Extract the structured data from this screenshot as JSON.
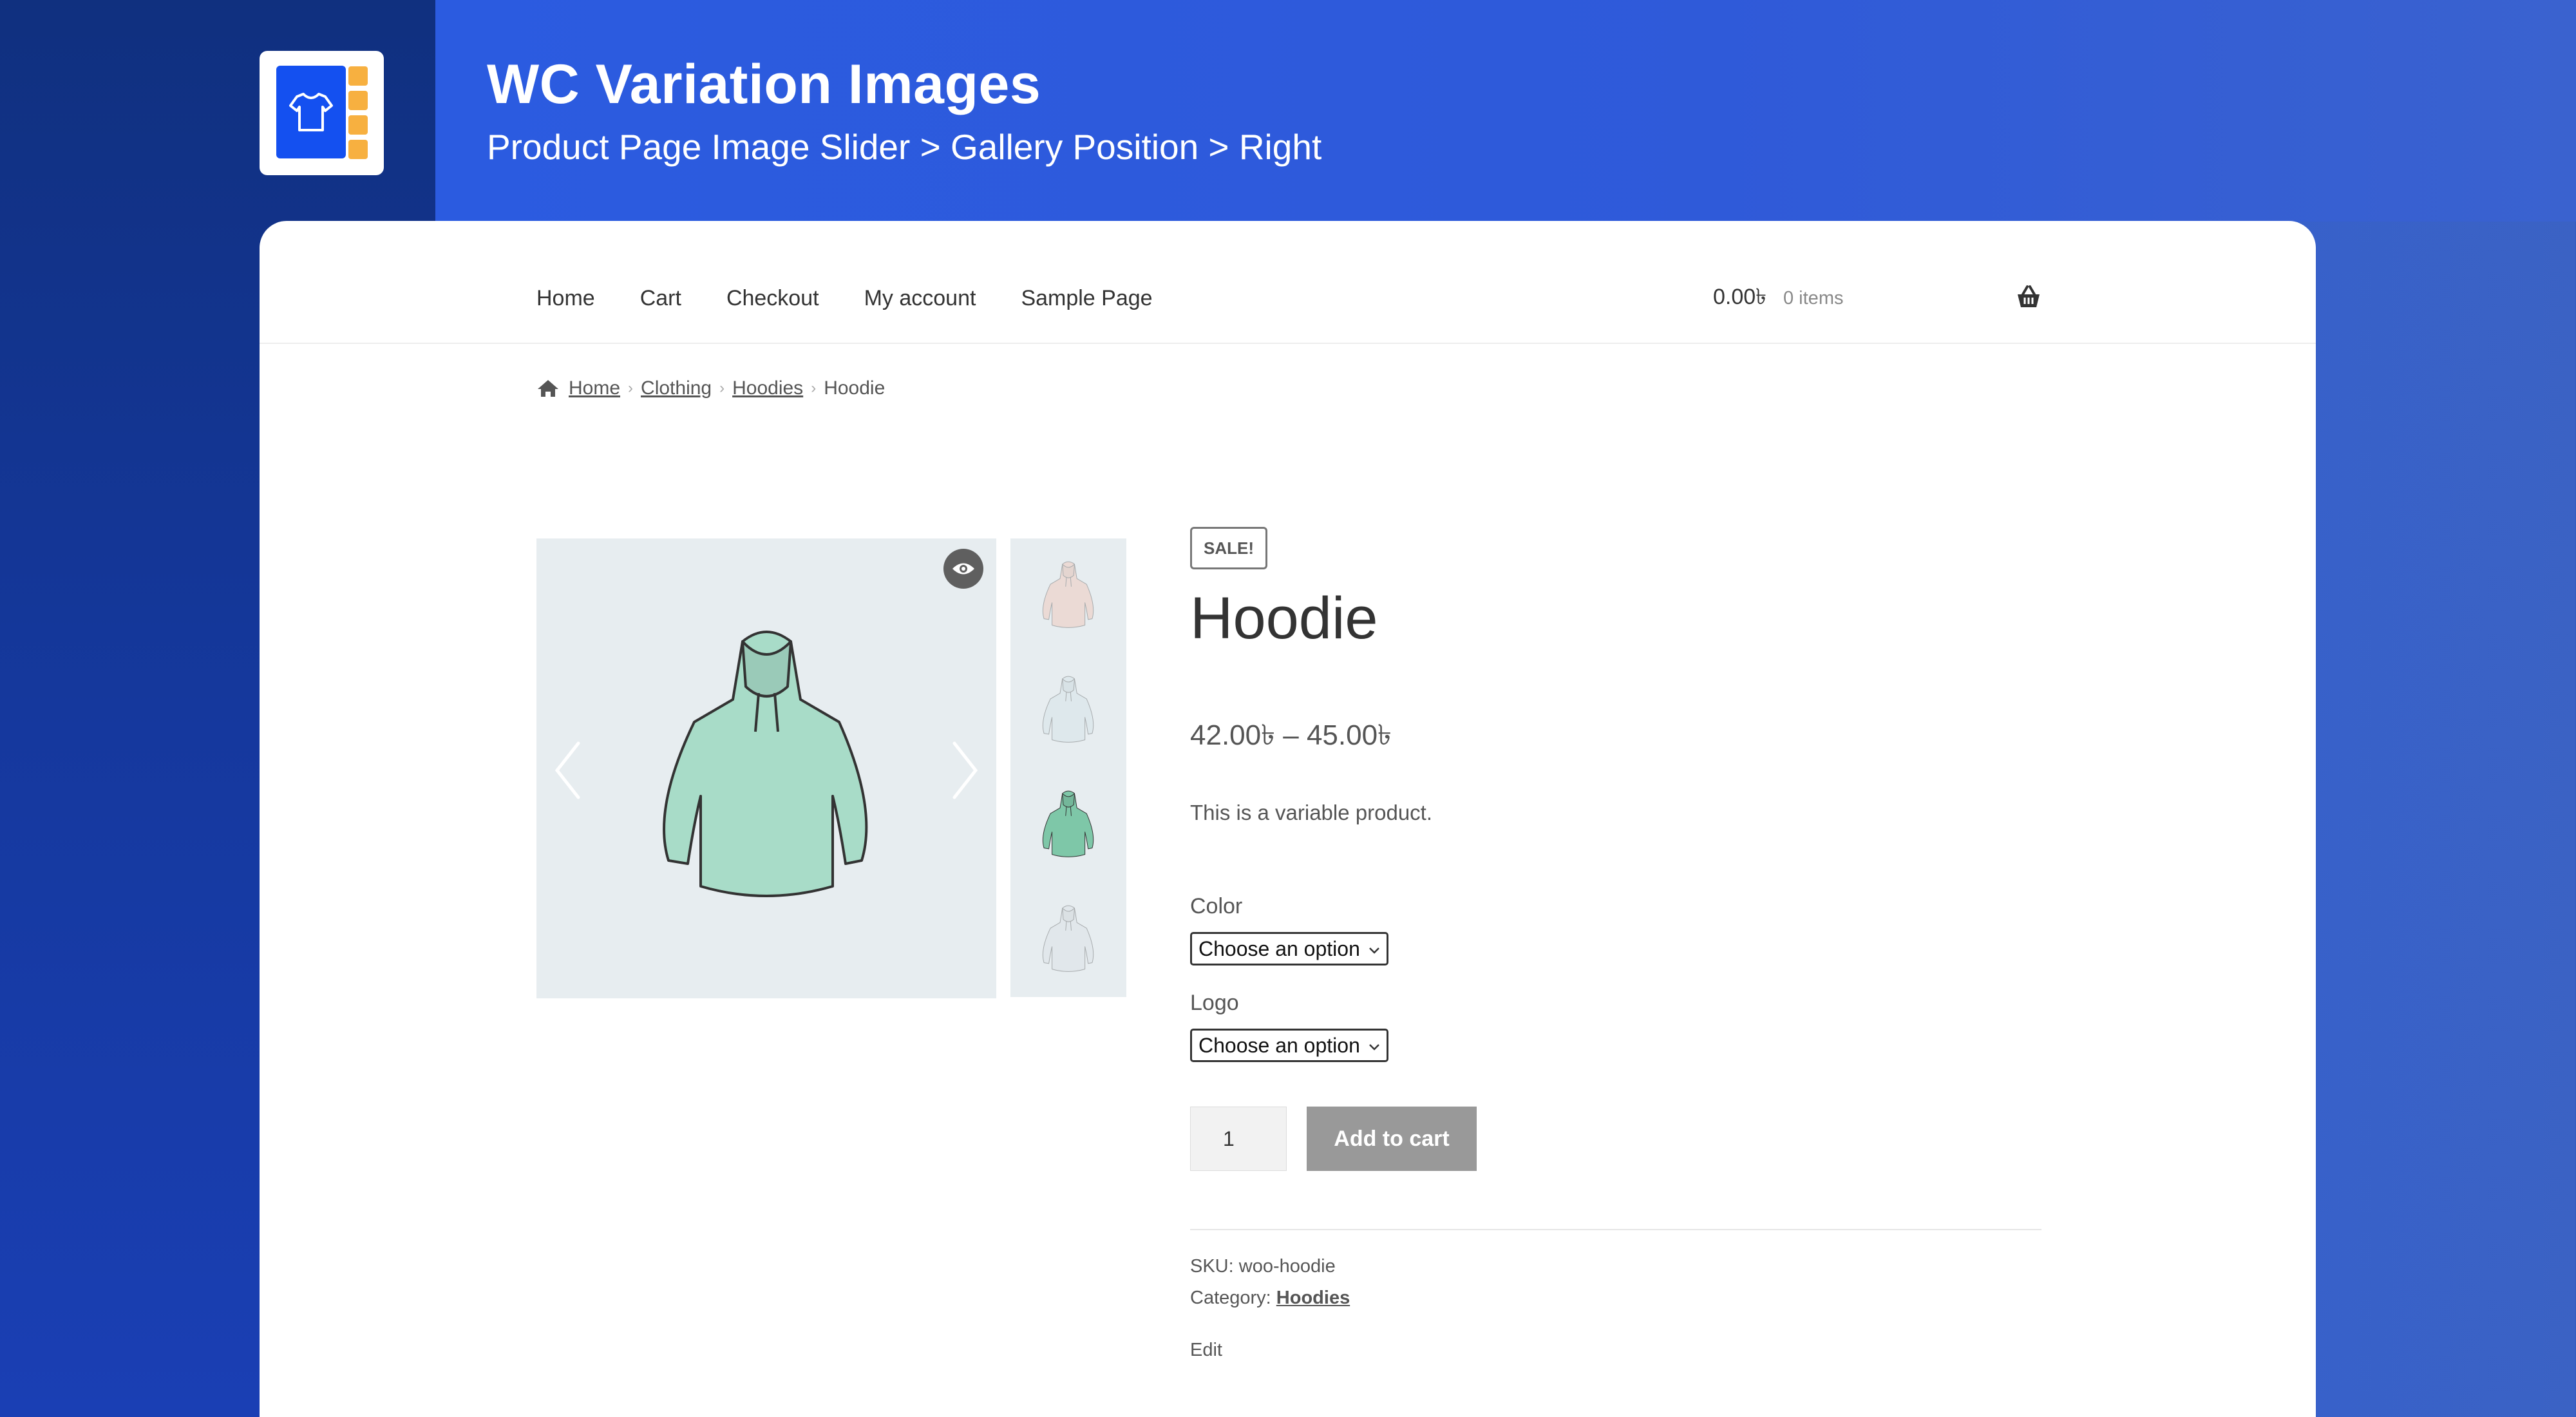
{
  "banner": {
    "title": "WC Variation Images",
    "subtitle": "Product Page Image Slider > Gallery Position > Right"
  },
  "nav": {
    "items": [
      "Home",
      "Cart",
      "Checkout",
      "My account",
      "Sample Page"
    ]
  },
  "cart": {
    "amount": "0.00৳",
    "count": "0 items"
  },
  "breadcrumb": {
    "home": "Home",
    "clothing": "Clothing",
    "hoodies": "Hoodies",
    "current": "Hoodie"
  },
  "product": {
    "badge": "SALE!",
    "title": "Hoodie",
    "price": "42.00৳  – 45.00৳",
    "description": "This is a variable product.",
    "color_label": "Color",
    "color_value": "Choose an option",
    "logo_label": "Logo",
    "logo_value": "Choose an option",
    "quantity": "1",
    "add_to_cart": "Add to cart",
    "sku_label": "SKU:",
    "sku_value": "woo-hoodie",
    "category_label": "Category:",
    "category_value": "Hoodies",
    "edit": "Edit"
  },
  "gallery": {
    "main_color": "#a8dcc8",
    "thumbs": [
      {
        "color": "#f3b8a4",
        "active": false
      },
      {
        "color": "#cfe0e6",
        "active": false
      },
      {
        "color": "#7ec7a8",
        "active": true
      },
      {
        "color": "#d6dde2",
        "active": false
      }
    ]
  }
}
